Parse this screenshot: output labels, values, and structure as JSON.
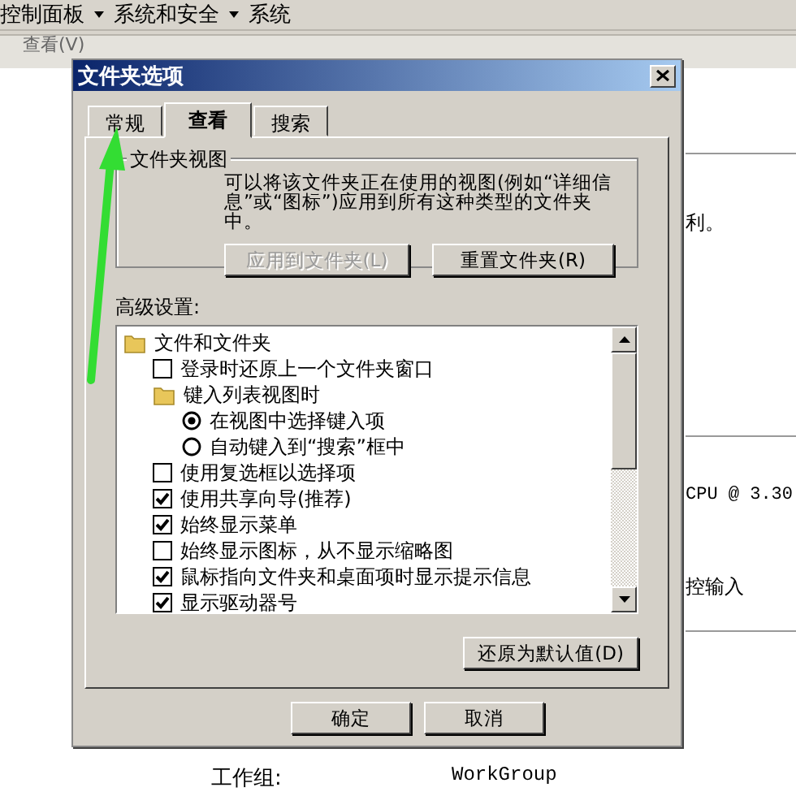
{
  "breadcrumb": [
    "控制面板",
    "系统和安全",
    "系统"
  ],
  "menu": [
    "查看(V)"
  ],
  "background": {
    "right_texts": [
      "利。",
      "CPU @ 3.30",
      "控输入"
    ],
    "workgroup": {
      "label": "工作组:",
      "value": "WorkGroup"
    }
  },
  "dialog": {
    "title": "文件夹选项",
    "tabs": [
      {
        "label": "常规",
        "selected": false
      },
      {
        "label": "查看",
        "selected": true
      },
      {
        "label": "搜索",
        "selected": false
      }
    ],
    "folder_views": {
      "label": "文件夹视图",
      "description": "可以将该文件夹正在使用的视图(例如“详细信息”或“图标”)应用到所有这种类型的文件夹中。",
      "buttons": [
        {
          "label": "应用到文件夹(L)",
          "disabled": true
        },
        {
          "label": "重置文件夹(R)",
          "disabled": false
        }
      ]
    },
    "advanced_label": "高级设置:",
    "tree": [
      {
        "kind": "folder",
        "label": "文件和文件夹",
        "children": [
          {
            "kind": "checkbox",
            "label": "登录时还原上一个文件夹窗口",
            "checked": false
          },
          {
            "kind": "folder",
            "label": "键入列表视图时",
            "children": [
              {
                "kind": "radio",
                "label": "在视图中选择键入项",
                "selected": true
              },
              {
                "kind": "radio",
                "label": "自动键入到“搜索”框中",
                "selected": false
              }
            ]
          },
          {
            "kind": "checkbox",
            "label": "使用复选框以选择项",
            "checked": false
          },
          {
            "kind": "checkbox",
            "label": "使用共享向导(推荐)",
            "checked": true
          },
          {
            "kind": "checkbox",
            "label": "始终显示菜单",
            "checked": true
          },
          {
            "kind": "checkbox",
            "label": "始终显示图标，从不显示缩略图",
            "checked": false
          },
          {
            "kind": "checkbox",
            "label": "鼠标指向文件夹和桌面项时显示提示信息",
            "checked": true
          },
          {
            "kind": "checkbox",
            "label": "显示驱动器号",
            "checked": true
          }
        ]
      }
    ],
    "restore_button": "还原为默认值(D)",
    "buttons": [
      "确定",
      "取消"
    ]
  }
}
